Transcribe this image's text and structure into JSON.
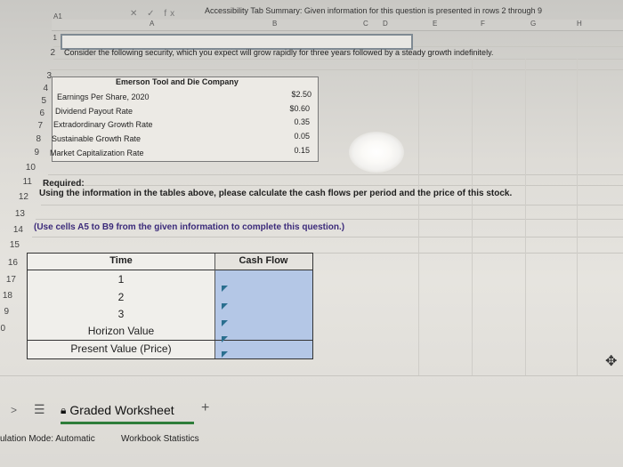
{
  "formula_bar": {
    "name_box": "A1",
    "icons": "✕ ✓ fx",
    "content": "Accessibility Tab Summary: Given information for this question is presented in rows 2 through 9"
  },
  "columns": [
    "A",
    "B",
    "C",
    "D",
    "E",
    "F",
    "G",
    "H"
  ],
  "rows": [
    "1",
    "2",
    "3",
    "4",
    "5",
    "6",
    "7",
    "8",
    "9",
    "10",
    "11",
    "12",
    "13",
    "14",
    "15",
    "16",
    "17",
    "18",
    "9",
    "0"
  ],
  "prompt": "Consider the following security, which you expect will grow rapidly for three years followed by a steady growth indefinitely.",
  "company_table": {
    "title": "Emerson Tool and Die Company",
    "rows": [
      {
        "label": "Earnings Per Share, 2020",
        "value": "$2.50"
      },
      {
        "label": "Dividend Payout Rate",
        "value": "$0.60"
      },
      {
        "label": "Extradordinary Growth Rate",
        "value": "0.35"
      },
      {
        "label": "Sustainable Growth Rate",
        "value": "0.05"
      },
      {
        "label": "Market Capitalization Rate",
        "value": "0.15"
      }
    ]
  },
  "required_label": "Required:",
  "instruction": "Using the information in the tables above, please calculate the cash flows per period and the price of this stock.",
  "note": "(Use cells A5 to B9 from the given information to complete this question.)",
  "time_table": {
    "header_time": "Time",
    "header_cf": "Cash Flow",
    "rows": [
      "1",
      "2",
      "3",
      "Horizon Value",
      "Present Value (Price)"
    ]
  },
  "tabs": {
    "active": "Graded Worksheet",
    "add": "+"
  },
  "status_bar": {
    "calculation": "ulation Mode: Automatic",
    "stats": "Workbook Statistics"
  },
  "colors": {
    "input_fill": "#b4c7e6",
    "active_tab_underline": "#2e7d3a",
    "note_text": "#3b2a7a"
  }
}
